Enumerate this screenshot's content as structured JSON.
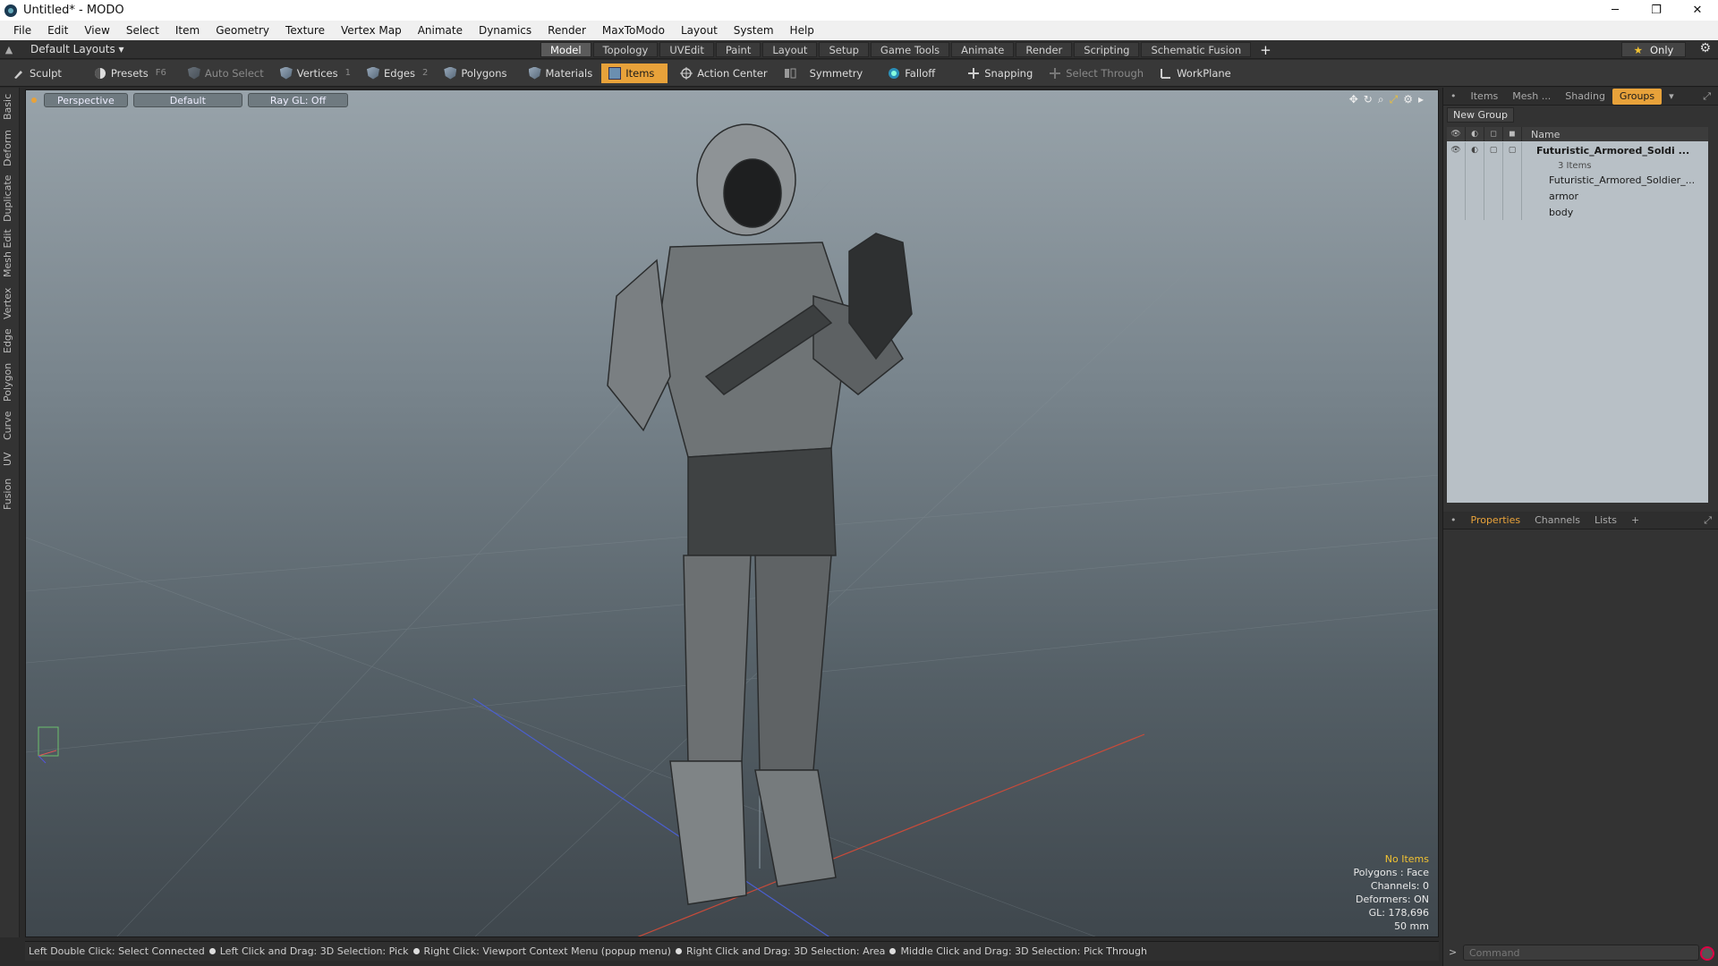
{
  "window": {
    "title": "Untitled* - MODO",
    "minimize": "─",
    "maximize": "❐",
    "close": "✕"
  },
  "menu": [
    "File",
    "Edit",
    "View",
    "Select",
    "Item",
    "Geometry",
    "Texture",
    "Vertex Map",
    "Animate",
    "Dynamics",
    "Render",
    "MaxToModo",
    "Layout",
    "System",
    "Help"
  ],
  "layoutbar": {
    "layout_select": "Default Layouts ▾",
    "tabs": [
      "Model",
      "Topology",
      "UVEdit",
      "Paint",
      "Layout",
      "Setup",
      "Game Tools",
      "Animate",
      "Render",
      "Scripting",
      "Schematic Fusion"
    ],
    "active_tab": "Model",
    "plus": "+",
    "only": "Only",
    "gear": "⚙"
  },
  "toolbar": {
    "sculpt": "Sculpt",
    "presets": "Presets",
    "presets_key": "F6",
    "auto_select": "Auto Select",
    "vertices": "Vertices",
    "vertices_num": "1",
    "edges": "Edges",
    "edges_num": "2",
    "polygons": "Polygons",
    "materials": "Materials",
    "items": "Items",
    "action_center": "Action Center",
    "symmetry": "Symmetry",
    "falloff": "Falloff",
    "snapping": "Snapping",
    "select_through": "Select Through",
    "workplane": "WorkPlane"
  },
  "left_tabs": [
    "Basic",
    "Deform",
    "Duplicate",
    "Mesh Edit",
    "Vertex",
    "Edge",
    "Polygon",
    "Curve",
    "UV",
    "Fusion"
  ],
  "viewport": {
    "view_mode": "Perspective",
    "shading": "Default",
    "raygl": "Ray GL: Off",
    "info": {
      "no_items": "No Items",
      "polygons": "Polygons : Face",
      "channels": "Channels: 0",
      "deformers": "Deformers: ON",
      "gl": "GL: 178,696",
      "scale": "50 mm"
    }
  },
  "statusbar": {
    "hints": [
      "Left Double Click: Select Connected",
      "Left Click and Drag: 3D Selection: Pick",
      "Right Click: Viewport Context Menu (popup menu)",
      "Right Click and Drag: 3D Selection: Area",
      "Middle Click and Drag: 3D Selection: Pick Through"
    ]
  },
  "right_panel": {
    "tabs": [
      "Items",
      "Mesh ...",
      "Shading",
      "Groups"
    ],
    "active_tab": "Groups",
    "new_group": "New Group",
    "col_name": "Name",
    "groups": [
      {
        "label": "Futuristic_Armored_Soldi ...",
        "sub": "3 Items",
        "bold": true
      },
      {
        "label": "Futuristic_Armored_Soldier_...",
        "bold": false
      },
      {
        "label": "armor",
        "bold": false
      },
      {
        "label": "body",
        "bold": false
      }
    ],
    "lower_tabs": [
      "Properties",
      "Channels",
      "Lists"
    ],
    "lower_plus": "+",
    "command_placeholder": "Command"
  },
  "colors": {
    "accent": "#e8a23a",
    "highlight": "#f1c232"
  }
}
